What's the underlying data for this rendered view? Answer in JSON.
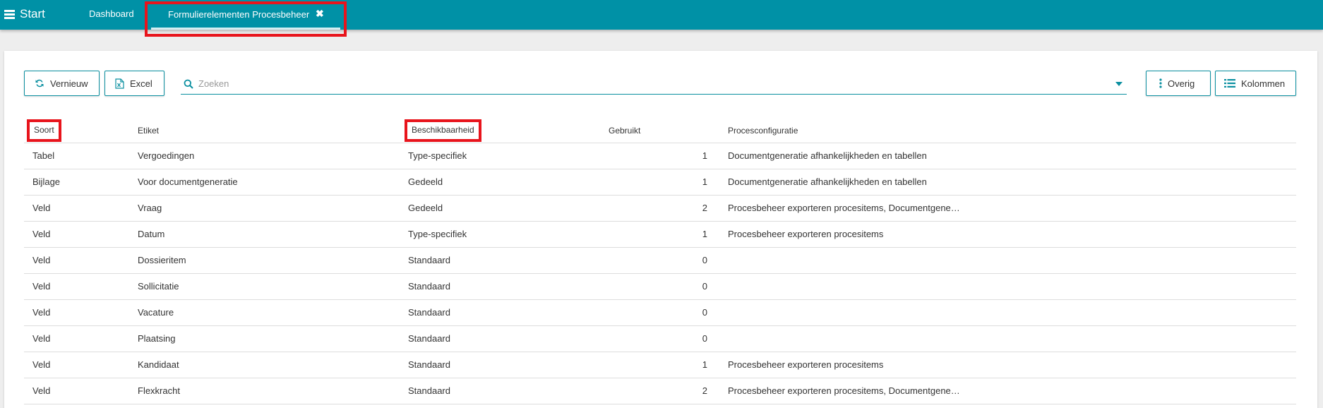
{
  "topbar": {
    "start_label": "Start",
    "tabs": [
      {
        "label": "Dashboard"
      },
      {
        "label": "Formulierelementen Procesbeheer",
        "close": "✖"
      }
    ]
  },
  "toolbar": {
    "vernieuw_label": "Vernieuw",
    "excel_label": "Excel",
    "search_placeholder": "Zoeken",
    "overig_label": "Overig",
    "kolommen_label": "Kolommen"
  },
  "table": {
    "columns": [
      "Soort",
      "Etiket",
      "Beschikbaarheid",
      "Gebruikt",
      "Procesconfiguratie"
    ],
    "rows": [
      {
        "soort": "Tabel",
        "etiket": "Vergoedingen",
        "beschik": "Type-specifiek",
        "gebruikt": "1",
        "proces": "Documentgeneratie afhankelijkheden en tabellen"
      },
      {
        "soort": "Bijlage",
        "etiket": "Voor documentgeneratie",
        "beschik": "Gedeeld",
        "gebruikt": "1",
        "proces": "Documentgeneratie afhankelijkheden en tabellen"
      },
      {
        "soort": "Veld",
        "etiket": "Vraag",
        "beschik": "Gedeeld",
        "gebruikt": "2",
        "proces": "Procesbeheer exporteren procesitems, Documentgener..."
      },
      {
        "soort": "Veld",
        "etiket": "Datum",
        "beschik": "Type-specifiek",
        "gebruikt": "1",
        "proces": "Procesbeheer exporteren procesitems"
      },
      {
        "soort": "Veld",
        "etiket": "Dossieritem",
        "beschik": "Standaard",
        "gebruikt": "0",
        "proces": ""
      },
      {
        "soort": "Veld",
        "etiket": "Sollicitatie",
        "beschik": "Standaard",
        "gebruikt": "0",
        "proces": ""
      },
      {
        "soort": "Veld",
        "etiket": "Vacature",
        "beschik": "Standaard",
        "gebruikt": "0",
        "proces": ""
      },
      {
        "soort": "Veld",
        "etiket": "Plaatsing",
        "beschik": "Standaard",
        "gebruikt": "0",
        "proces": ""
      },
      {
        "soort": "Veld",
        "etiket": "Kandidaat",
        "beschik": "Standaard",
        "gebruikt": "1",
        "proces": "Procesbeheer exporteren procesitems"
      },
      {
        "soort": "Veld",
        "etiket": "Flexkracht",
        "beschik": "Standaard",
        "gebruikt": "2",
        "proces": "Procesbeheer exporteren procesitems, Documentgener..."
      }
    ]
  },
  "colors": {
    "topbar": "#0091a6",
    "accent": "#0a8fa0",
    "highlight": "#e8141c"
  }
}
